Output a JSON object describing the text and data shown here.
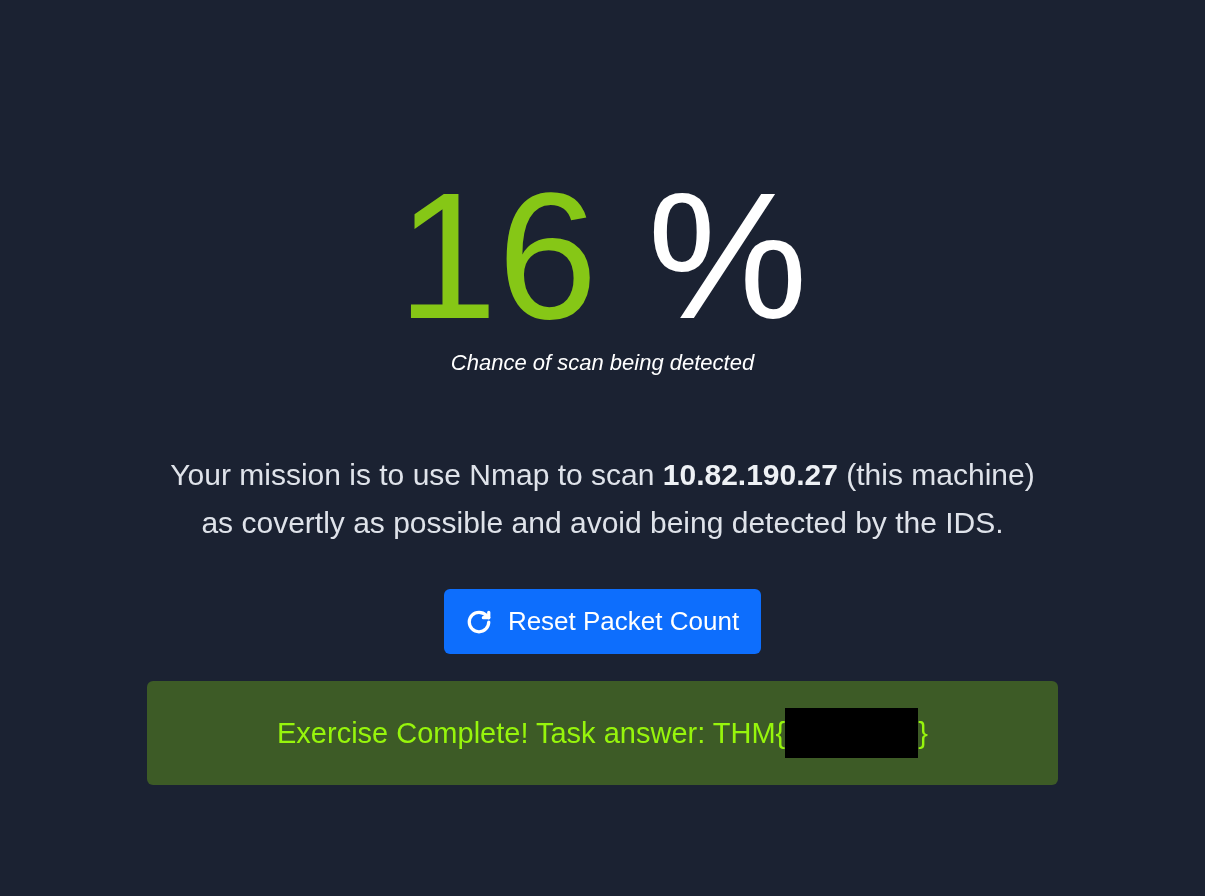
{
  "detection": {
    "value": "16",
    "unit": "%",
    "caption": "Chance of scan being detected"
  },
  "mission": "Your mission is to use Nmap to scan **10.82.190.27** (this machine) as covertly as possible and avoid being detected by the IDS.",
  "reset_button": {
    "label": "Reset Packet Count"
  },
  "alert": {
    "text": "Exercise Complete! Task answer: THM{",
    "redacted": true,
    "closing": "}"
  }
}
